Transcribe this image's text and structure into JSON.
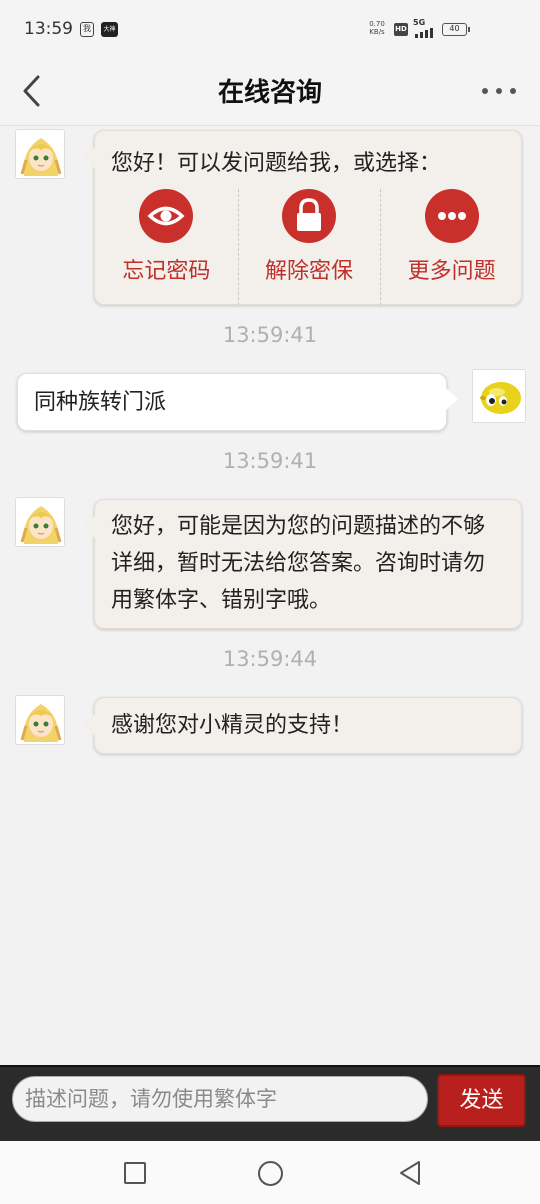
{
  "status_bar": {
    "time": "13:59",
    "app_badge_1": "我",
    "app_badge_2": "大神",
    "net_speed_value": "0.70",
    "net_speed_unit": "KB/s",
    "hd": "HD",
    "network": "5G",
    "battery": "40"
  },
  "header": {
    "title": "在线咨询",
    "back_icon": "chevron-left-icon",
    "more_icon": "more-horizontal-icon"
  },
  "messages": {
    "m1": {
      "sender": "bot",
      "text": "您好！可以发问题给我，或选择：",
      "options": [
        {
          "label": "忘记密码",
          "icon": "eye-icon"
        },
        {
          "label": "解除密保",
          "icon": "lock-icon"
        },
        {
          "label": "更多问题",
          "icon": "more-dots-icon"
        }
      ]
    },
    "ts1": "13:59:41",
    "m2": {
      "sender": "user",
      "text": "同种族转门派"
    },
    "ts2": "13:59:41",
    "m3": {
      "sender": "bot",
      "text": "您好，可能是因为您的问题描述的不够详细，暂时无法给您答案。咨询时请勿用繁体字、错别字哦。"
    },
    "ts3": "13:59:44",
    "m4": {
      "sender": "bot",
      "text": "感谢您对小精灵的支持！"
    }
  },
  "input_bar": {
    "placeholder": "描述问题，请勿使用繁体字",
    "send_label": "发送"
  },
  "colors": {
    "accent": "#c9302c",
    "send_button": "#b8201d",
    "bot_bubble": "#f3efea",
    "user_bubble": "#ffffff",
    "timestamp": "#b0b0b0"
  }
}
